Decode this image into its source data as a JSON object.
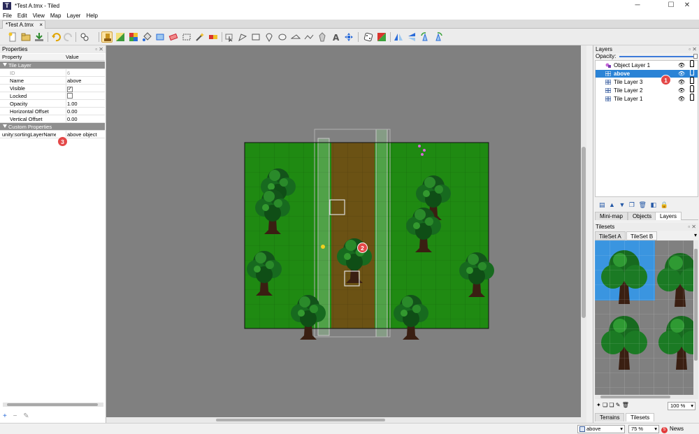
{
  "window": {
    "title": "*Test A.tmx - Tiled",
    "minimize": "─",
    "maximize": "☐",
    "close": "✕"
  },
  "menu": [
    "File",
    "Edit",
    "View",
    "Map",
    "Layer",
    "Help"
  ],
  "document_tab": {
    "label": "*Test A.tmx",
    "close": "×"
  },
  "properties_panel": {
    "title": "Properties",
    "col_property": "Property",
    "col_value": "Value",
    "group_tile_layer": "Tile Layer",
    "rows": [
      {
        "key": "ID",
        "value": "6",
        "dim": true
      },
      {
        "key": "Name",
        "value": "above"
      },
      {
        "key": "Visible",
        "checkbox": true,
        "checked": true
      },
      {
        "key": "Locked",
        "checkbox": true,
        "checked": false
      },
      {
        "key": "Opacity",
        "value": "1.00"
      },
      {
        "key": "Horizontal Offset",
        "value": "0.00"
      },
      {
        "key": "Vertical Offset",
        "value": "0.00"
      }
    ],
    "group_custom": "Custom Properties",
    "custom_rows": [
      {
        "key": "unity:sortingLayerName",
        "value": "above object"
      }
    ],
    "tools": {
      "add": "+",
      "remove": "−",
      "edit": "✎"
    }
  },
  "layers_panel": {
    "title": "Layers",
    "opacity_label": "Opacity:",
    "opacity_value": 1.0,
    "layers": [
      {
        "name": "Object Layer 1",
        "type": "object",
        "selected": false
      },
      {
        "name": "above",
        "type": "tile",
        "selected": true
      },
      {
        "name": "Tile Layer 3",
        "type": "tile",
        "selected": false
      },
      {
        "name": "Tile Layer 2",
        "type": "tile",
        "selected": false
      },
      {
        "name": "Tile Layer 1",
        "type": "tile",
        "selected": false
      }
    ],
    "eye_glyph": "👁"
  },
  "dock_tabs": [
    "Mini-map",
    "Objects",
    "Layers"
  ],
  "tilesets_panel": {
    "title": "Tilesets",
    "tabs": [
      "TileSet A",
      "TileSet B"
    ],
    "zoom": "100 %"
  },
  "bottom_tabs": [
    "Terrains",
    "Tilesets"
  ],
  "statusbar": {
    "layer": "above",
    "zoom": "75 %",
    "news": "News"
  },
  "badges": [
    "1",
    "2",
    "3"
  ],
  "colors": {
    "selection": "#2a83d6",
    "badge": "#e44848",
    "grass": "#1f8a12",
    "path": "#6b5214"
  }
}
